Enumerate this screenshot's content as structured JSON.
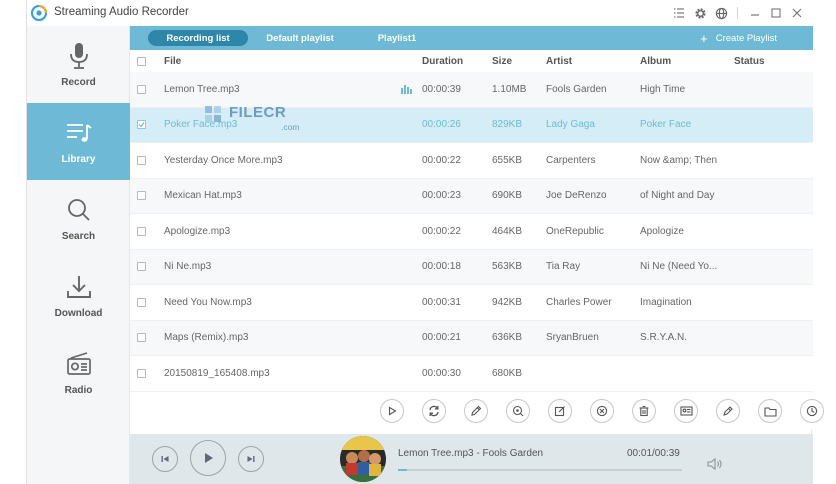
{
  "app": {
    "title": "Streaming Audio Recorder"
  },
  "sidebar": {
    "items": [
      {
        "label": "Record",
        "icon": "microphone-icon"
      },
      {
        "label": "Library",
        "icon": "music-list-icon",
        "active": true
      },
      {
        "label": "Search",
        "icon": "search-icon"
      },
      {
        "label": "Download",
        "icon": "download-icon"
      },
      {
        "label": "Radio",
        "icon": "radio-icon"
      }
    ]
  },
  "tabs": {
    "items": [
      {
        "label": "Recording list",
        "active": true
      },
      {
        "label": "Default playlist"
      },
      {
        "label": "Playlist1"
      }
    ],
    "create_label": "Create Playlist"
  },
  "table": {
    "headers": {
      "file": "File",
      "duration": "Duration",
      "size": "Size",
      "artist": "Artist",
      "album": "Album",
      "status": "Status"
    },
    "rows": [
      {
        "file": "Lemon Tree.mp3",
        "duration": "00:00:39",
        "size": "1.10MB",
        "artist": "Fools Garden",
        "album": "High Time",
        "checked": false,
        "playing": true
      },
      {
        "file": "Poker Face.mp3",
        "duration": "00:00:26",
        "size": "829KB",
        "artist": "Lady Gaga",
        "album": "Poker Face",
        "checked": true,
        "selected": true
      },
      {
        "file": "Yesterday Once More.mp3",
        "duration": "00:00:22",
        "size": "655KB",
        "artist": "Carpenters",
        "album": "Now &amp; Then",
        "checked": false
      },
      {
        "file": "Mexican Hat.mp3",
        "duration": "00:00:23",
        "size": "690KB",
        "artist": "Joe DeRenzo",
        "album": "of Night and Day",
        "checked": false
      },
      {
        "file": "Apologize.mp3",
        "duration": "00:00:22",
        "size": "464KB",
        "artist": "OneRepublic",
        "album": "Apologize",
        "checked": false
      },
      {
        "file": "Ni Ne.mp3",
        "duration": "00:00:18",
        "size": "563KB",
        "artist": "Tia Ray",
        "album": "Ni Ne (Need Yo...",
        "checked": false
      },
      {
        "file": "Need You Now.mp3",
        "duration": "00:00:31",
        "size": "942KB",
        "artist": "Charles Power",
        "album": "Imagination",
        "checked": false
      },
      {
        "file": "Maps (Remix).mp3",
        "duration": "00:00:21",
        "size": "636KB",
        "artist": "SryanBruen",
        "album": "S.R.Y.A.N.",
        "checked": false
      },
      {
        "file": "20150819_165408.mp3",
        "duration": "00:00:30",
        "size": "680KB",
        "artist": "",
        "album": "",
        "checked": false
      }
    ]
  },
  "watermark": {
    "brand": "FILECR",
    "suffix": ".com"
  },
  "actions": [
    "play-icon",
    "convert-icon",
    "edit-icon",
    "identify-icon",
    "edit-tag-icon",
    "delete-icon",
    "trash-icon",
    "id3-icon",
    "ringtone-icon",
    "folder-icon",
    "schedule-icon"
  ],
  "player": {
    "now_playing": "Lemon Tree.mp3 - Fools Garden",
    "time": "00:01/00:39",
    "progress": 0.03
  },
  "colors": {
    "accent": "#6ebad6",
    "tab_active": "#2e86a8",
    "selected_row": "#d4edf7"
  }
}
